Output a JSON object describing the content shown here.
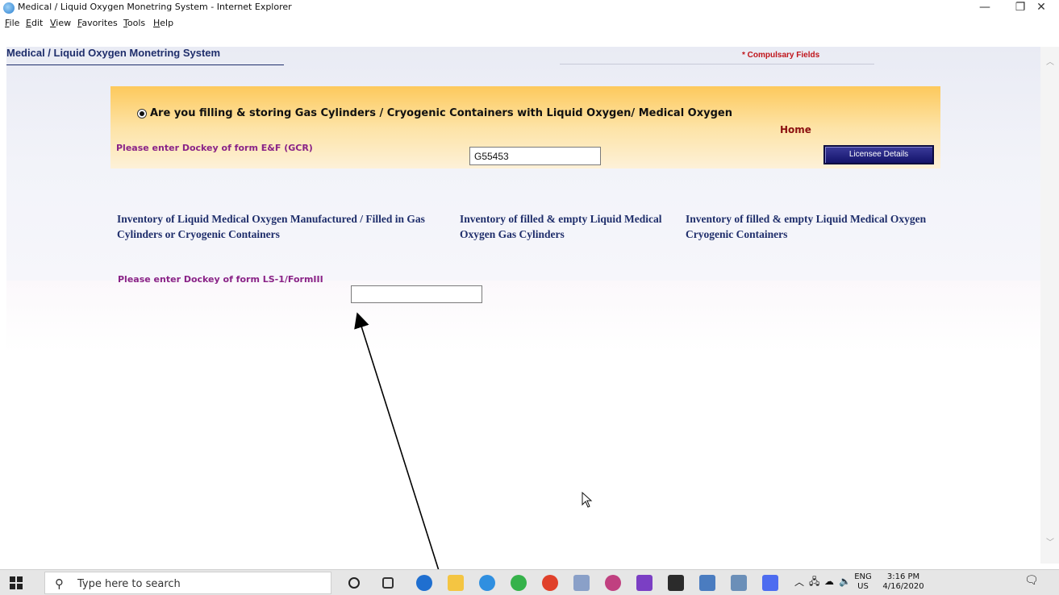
{
  "window": {
    "title": "Medical / Liquid Oxygen Monetring System - Internet Explorer",
    "minimize_glyph": "—",
    "restore_glyph": "❐",
    "close_glyph": "✕"
  },
  "menu": {
    "items": [
      "File",
      "Edit",
      "View",
      "Favorites",
      "Tools",
      "Help"
    ]
  },
  "page": {
    "header": "Medical / Liquid Oxygen Monetring System",
    "compulsory_note": "* Compulsary Fields",
    "question": "Are you filling & storing Gas Cylinders / Cryogenic Containers with Liquid Oxygen/ Medical Oxygen",
    "home_link": "Home",
    "ef_label": "Please enter Dockey of form E&F (GCR)",
    "ef_value": "G55453",
    "licensee_button": "Licensee Details",
    "inventory_links": [
      "Inventory of Liquid Medical Oxygen Manufactured / Filled in Gas Cylinders or Cryogenic Containers",
      "Inventory of filled & empty Liquid Medical Oxygen Gas Cylinders",
      "Inventory of filled & empty Liquid Medical Oxygen Cryogenic Containers"
    ],
    "ls_label": "Please enter Dockey of form LS-1/FormIII",
    "ls_value": ""
  },
  "taskbar": {
    "search_placeholder": "Type here to search",
    "lang_top": "ENG",
    "lang_bottom": "US",
    "time": "3:16 PM",
    "date": "4/16/2020"
  },
  "colors": {
    "header_navy": "#1f2e6b",
    "label_purple": "#8a2387",
    "compulsory_red": "#c0141a",
    "home_maroon": "#8b1010",
    "panel_orange": "#fdc95c"
  }
}
